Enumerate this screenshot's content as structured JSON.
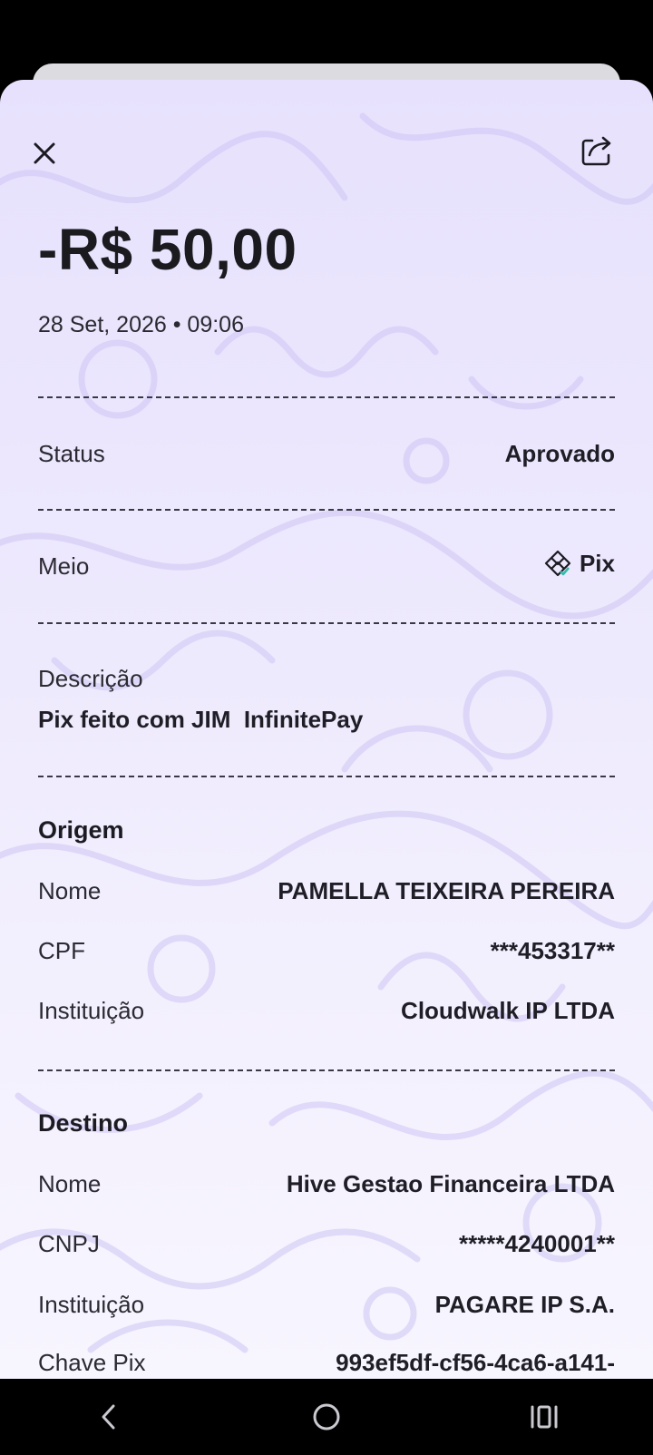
{
  "header": {
    "close_icon": "close-icon",
    "share_icon": "share-icon"
  },
  "transaction": {
    "amount": "-R$ 50,00",
    "datetime": "28 Set, 2026 • 09:06"
  },
  "status": {
    "label": "Status",
    "value": "Aprovado"
  },
  "meio": {
    "label": "Meio",
    "value": "Pix",
    "icon": "pix-icon"
  },
  "descricao": {
    "label": "Descrição",
    "value": "Pix feito com JIM  InfinitePay"
  },
  "origem": {
    "title": "Origem",
    "nome_label": "Nome",
    "nome_value": "PAMELLA TEIXEIRA PEREIRA",
    "cpf_label": "CPF",
    "cpf_value": "***453317**",
    "inst_label": "Instituição",
    "inst_value": "Cloudwalk IP LTDA"
  },
  "destino": {
    "title": "Destino",
    "nome_label": "Nome",
    "nome_value": "Hive Gestao Financeira LTDA",
    "cnpj_label": "CNPJ",
    "cnpj_value": "*****4240001**",
    "inst_label": "Instituição",
    "inst_value": "PAGARE IP S.A.",
    "chave_label": "Chave Pix",
    "chave_value": "993ef5df-cf56-4ca6-a141-"
  },
  "colors": {
    "sheet_bg": "#e7e1fd",
    "text": "#1c1b22",
    "pix_check": "#32bcad"
  },
  "nav": {
    "back_icon": "back-icon",
    "home_icon": "home-icon",
    "recents_icon": "recents-icon"
  }
}
